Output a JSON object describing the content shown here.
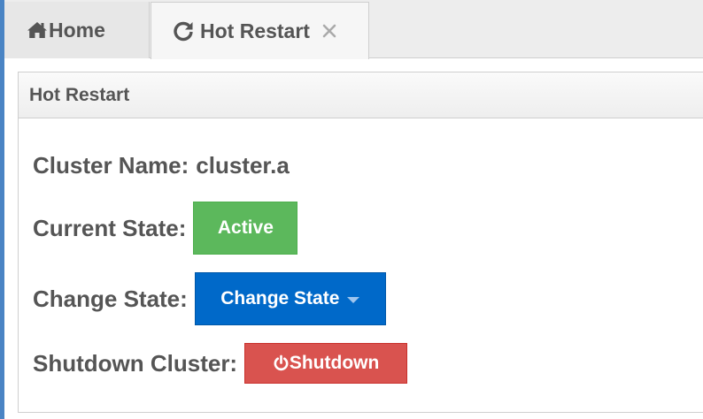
{
  "tabs": [
    {
      "label": "Home",
      "icon": "home-icon"
    },
    {
      "label": "Hot Restart",
      "icon": "refresh-icon",
      "close_glyph": "✕"
    }
  ],
  "panel": {
    "title": "Hot Restart"
  },
  "cluster": {
    "name_label": "Cluster Name:",
    "name_value": "cluster.a"
  },
  "current_state": {
    "label": "Current State:",
    "value": "Active"
  },
  "change_state": {
    "label": "Change State:",
    "button_label": "Change State"
  },
  "shutdown": {
    "label": "Shutdown Cluster:",
    "button_label": "Shutdown",
    "icon": "power-icon"
  },
  "colors": {
    "active_green": "#5cb85c",
    "change_blue": "#0069c9",
    "shutdown_red": "#d9534f",
    "text_gray": "#555555"
  }
}
